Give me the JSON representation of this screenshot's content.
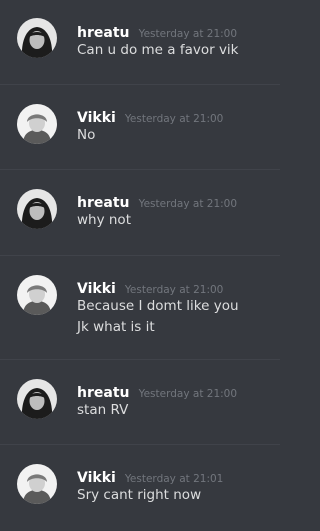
{
  "messages": [
    {
      "username": "hreatu",
      "timestamp": "Yesterday at 21:00",
      "lines": [
        "Can u do me a favor vik"
      ],
      "avatar_icon": "hreatu-avatar-icon"
    },
    {
      "username": "Vikki",
      "timestamp": "Yesterday at 21:00",
      "lines": [
        "No"
      ],
      "avatar_icon": "vikki-avatar-icon"
    },
    {
      "username": "hreatu",
      "timestamp": "Yesterday at 21:00",
      "lines": [
        "why not"
      ],
      "avatar_icon": "hreatu-avatar-icon"
    },
    {
      "username": "Vikki",
      "timestamp": "Yesterday at 21:00",
      "lines": [
        "Because I domt like you",
        "Jk what is it"
      ],
      "avatar_icon": "vikki-avatar-icon"
    },
    {
      "username": "hreatu",
      "timestamp": "Yesterday at 21:00",
      "lines": [
        "stan RV"
      ],
      "avatar_icon": "hreatu-avatar-icon"
    },
    {
      "username": "Vikki",
      "timestamp": "Yesterday at 21:01",
      "lines": [
        "Sry cant right now"
      ],
      "avatar_icon": "vikki-avatar-icon"
    }
  ],
  "colors": {
    "background": "#36393f",
    "divider": "#40434a",
    "username": "#ffffff",
    "timestamp": "#72767d",
    "text": "#dcddde"
  }
}
